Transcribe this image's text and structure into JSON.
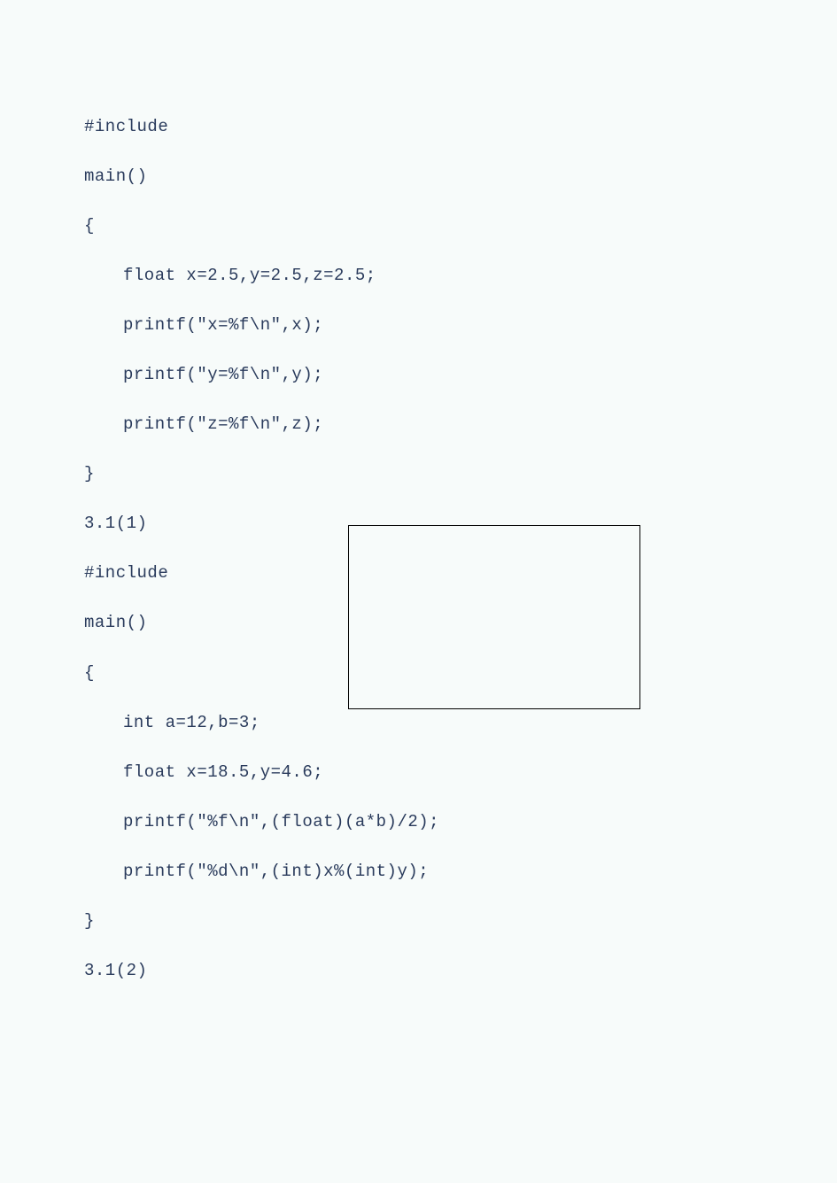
{
  "lines": {
    "l1": "#include",
    "l2": "main()",
    "l3": "{",
    "l4": "float x=2.5,y=2.5,z=2.5;",
    "l5": "printf(\"x=%f\\n\",x);",
    "l6": "printf(\"y=%f\\n\",y);",
    "l7": "printf(\"z=%f\\n\",z);",
    "l8": "}",
    "l9": "3.1(1)",
    "l10": "#include",
    "l11": "main()",
    "l12": "{",
    "l13": "int a=12,b=3;",
    "l14": "float x=18.5,y=4.6;",
    "l15": "printf(\"%f\\n\",(float)(a*b)/2);",
    "l16": "printf(\"%d\\n\",(int)x%(int)y);",
    "l17": "}",
    "l18": "3.1(2)"
  }
}
